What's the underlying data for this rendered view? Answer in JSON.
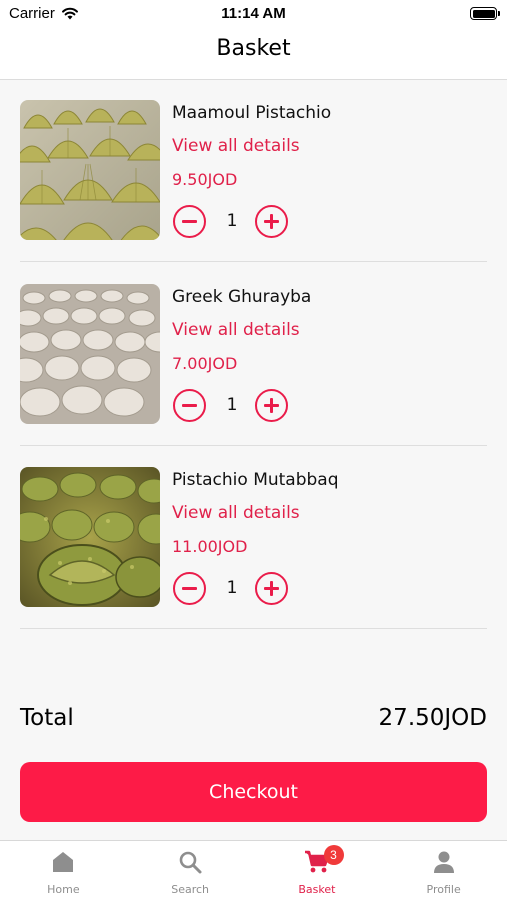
{
  "status_bar": {
    "carrier": "Carrier",
    "time": "11:14 AM"
  },
  "header": {
    "title": "Basket"
  },
  "items": [
    {
      "name": "Maamoul Pistachio",
      "details_link": "View all details",
      "price": "9.50JOD",
      "quantity": "1",
      "photo_icon": "maamoul-photo"
    },
    {
      "name": "Greek Ghurayba",
      "details_link": "View all details",
      "price": "7.00JOD",
      "quantity": "1",
      "photo_icon": "ghurayba-photo"
    },
    {
      "name": "Pistachio Mutabbaq",
      "details_link": "View all details",
      "price": "11.00JOD",
      "quantity": "1",
      "photo_icon": "mutabbaq-photo"
    }
  ],
  "summary": {
    "total_label": "Total",
    "total_value": "27.50JOD"
  },
  "checkout": {
    "label": "Checkout"
  },
  "tab_bar": {
    "tabs": [
      {
        "label": "Home",
        "icon": "home-icon"
      },
      {
        "label": "Search",
        "icon": "search-icon"
      },
      {
        "label": "Basket",
        "icon": "cart-icon",
        "badge": "3",
        "active": true
      },
      {
        "label": "Profile",
        "icon": "person-icon"
      }
    ]
  },
  "colors": {
    "accent": "#fd1b47",
    "price_text": "#e0214a",
    "badge": "#f03a3a",
    "inactive_tab": "#8e8e8e"
  }
}
